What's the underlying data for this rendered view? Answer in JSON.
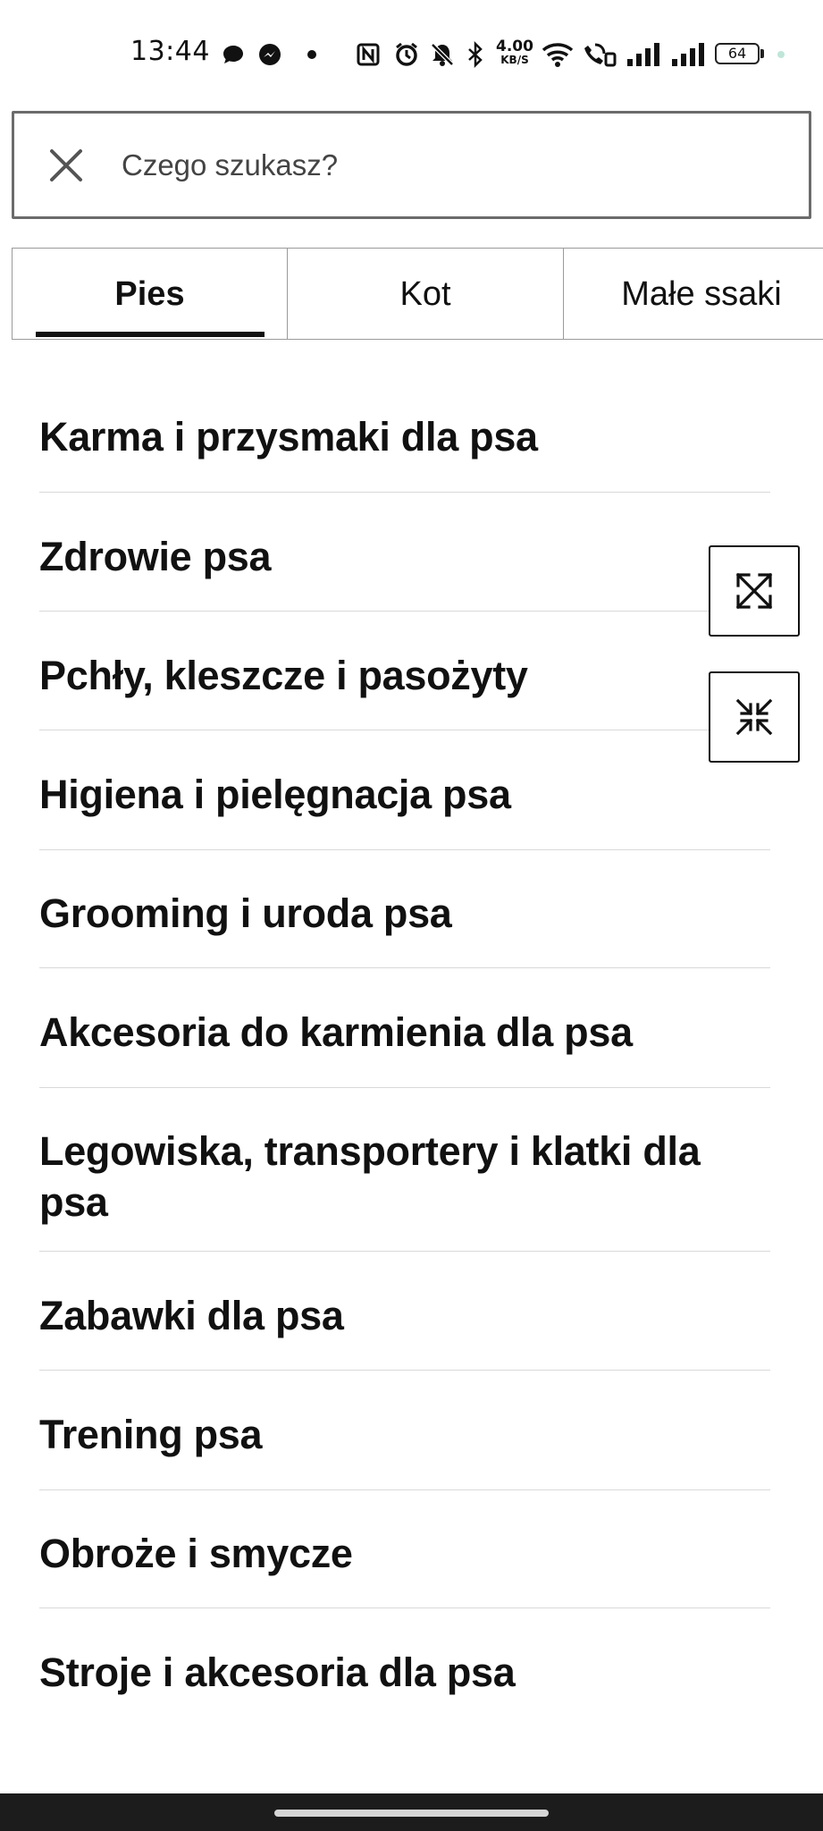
{
  "status_bar": {
    "time": "13:44",
    "net_speed_value": "4.00",
    "net_speed_unit": "KB/S",
    "battery": "64",
    "icons": [
      "chat-bubble-icon",
      "messenger-icon",
      "dot-icon",
      "nfc-icon",
      "alarm-icon",
      "mute-bell-icon",
      "bluetooth-icon",
      "wifi-icon",
      "wifi-calling-icon",
      "signal-icon",
      "signal-icon",
      "battery-icon"
    ]
  },
  "search": {
    "placeholder": "Czego szukasz?",
    "value": "",
    "close_icon": "close-icon"
  },
  "tabs": [
    {
      "label": "Pies",
      "active": true
    },
    {
      "label": "Kot",
      "active": false
    },
    {
      "label": "Małe ssaki",
      "active": false
    }
  ],
  "categories": [
    "Karma i przysmaki dla psa",
    "Zdrowie psa",
    "Pchły, kleszcze i pasożyty",
    "Higiena i pielęgnacja psa",
    "Grooming i uroda psa",
    "Akcesoria do karmienia dla psa",
    "Legowiska, transportery i klatki dla psa",
    "Zabawki dla psa",
    "Trening psa",
    "Obroże i smycze",
    "Stroje i akcesoria dla psa"
  ],
  "floating_buttons": [
    "expand-icon",
    "collapse-icon"
  ],
  "colors": {
    "text": "#111111",
    "border": "#6b6b6b",
    "divider": "#d9d9d9",
    "navbar": "#1c1c1c"
  }
}
